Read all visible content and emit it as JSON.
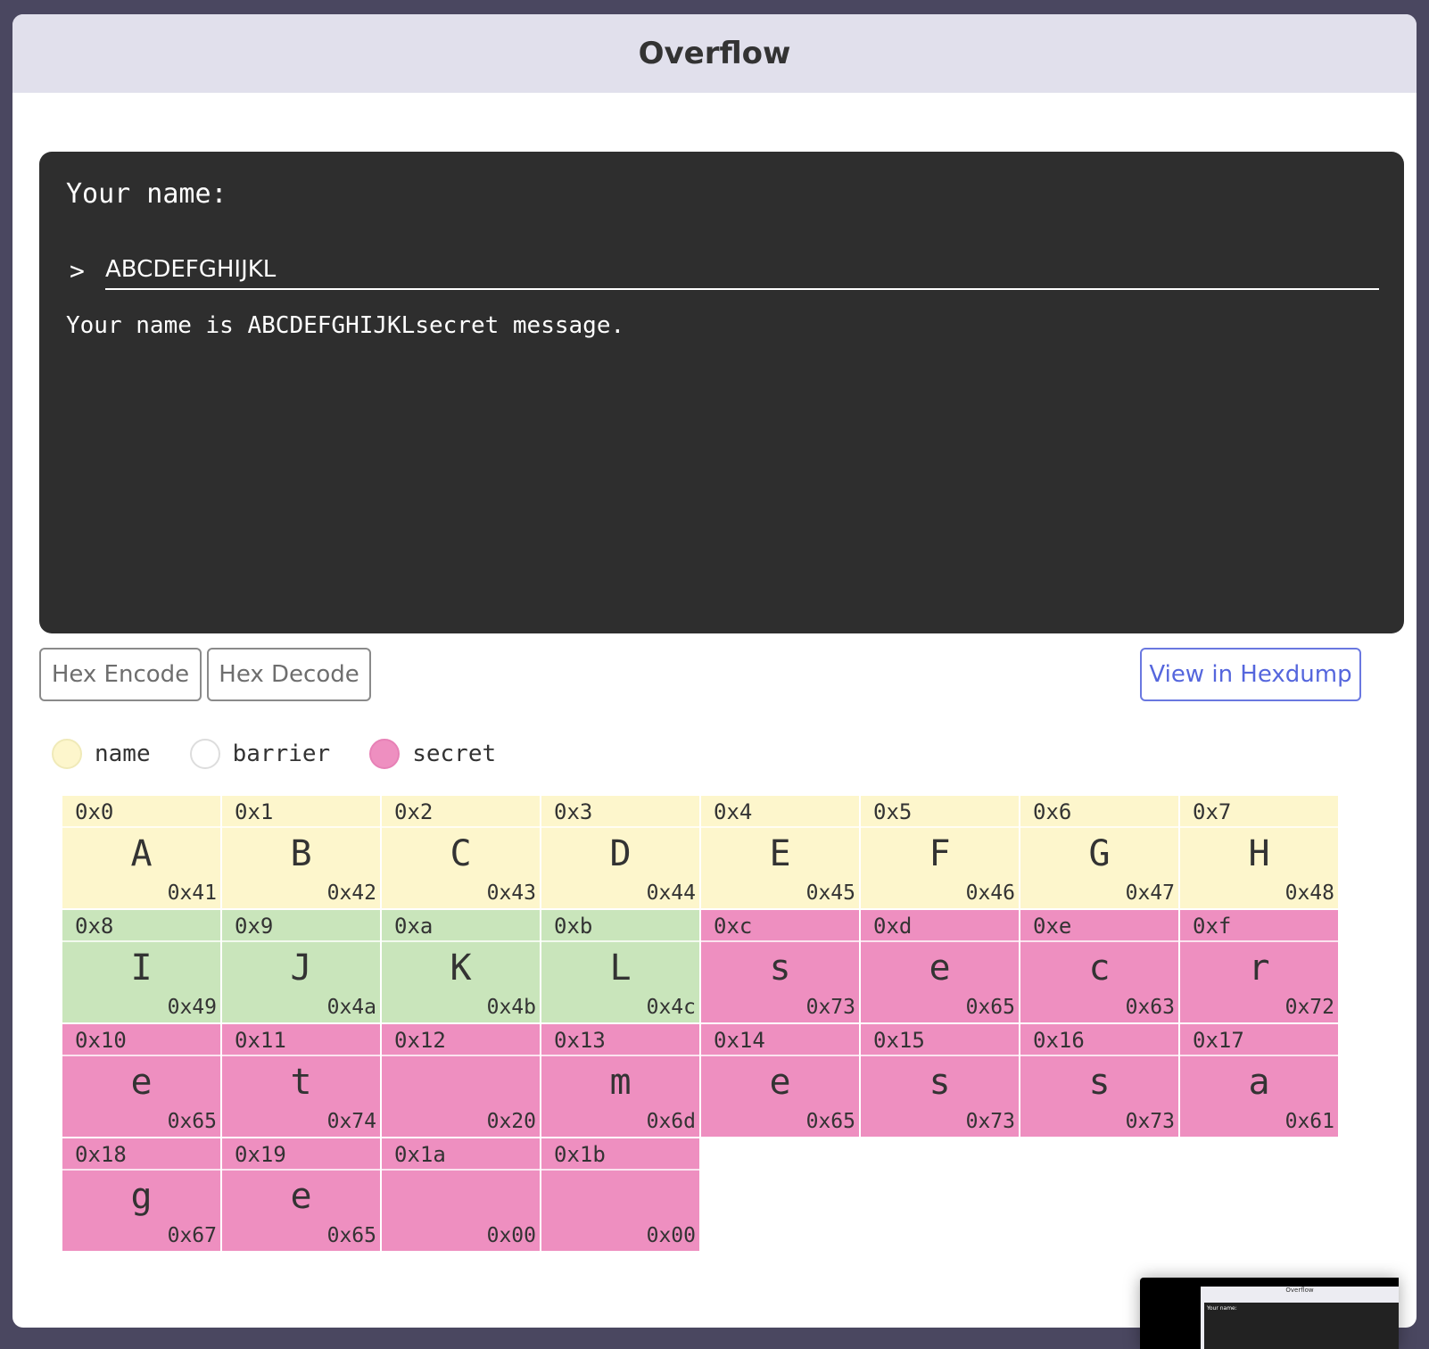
{
  "window": {
    "title": "Overflow"
  },
  "terminal": {
    "prompt": "Your name:",
    "chevron": ">",
    "input_value": "ABCDEFGHIJKL",
    "output": "Your name is ABCDEFGHIJKLsecret message."
  },
  "buttons": {
    "hex_encode": "Hex Encode",
    "hex_decode": "Hex Decode",
    "hexdump": "View in Hexdump"
  },
  "legend": [
    {
      "label": "name",
      "color": "#fdf6cc"
    },
    {
      "label": "barrier",
      "color": "#ffffff"
    },
    {
      "label": "secret",
      "color": "#ee8fc0"
    }
  ],
  "colors": {
    "name": "#fdf6cc",
    "barrier": "#c9e5bb",
    "secret": "#ee8fc0",
    "accent": "#5566dd"
  },
  "memory": [
    {
      "addr": "0x0",
      "char": "A",
      "hex": "0x41",
      "region": "name"
    },
    {
      "addr": "0x1",
      "char": "B",
      "hex": "0x42",
      "region": "name"
    },
    {
      "addr": "0x2",
      "char": "C",
      "hex": "0x43",
      "region": "name"
    },
    {
      "addr": "0x3",
      "char": "D",
      "hex": "0x44",
      "region": "name"
    },
    {
      "addr": "0x4",
      "char": "E",
      "hex": "0x45",
      "region": "name"
    },
    {
      "addr": "0x5",
      "char": "F",
      "hex": "0x46",
      "region": "name"
    },
    {
      "addr": "0x6",
      "char": "G",
      "hex": "0x47",
      "region": "name"
    },
    {
      "addr": "0x7",
      "char": "H",
      "hex": "0x48",
      "region": "name"
    },
    {
      "addr": "0x8",
      "char": "I",
      "hex": "0x49",
      "region": "barrier"
    },
    {
      "addr": "0x9",
      "char": "J",
      "hex": "0x4a",
      "region": "barrier"
    },
    {
      "addr": "0xa",
      "char": "K",
      "hex": "0x4b",
      "region": "barrier"
    },
    {
      "addr": "0xb",
      "char": "L",
      "hex": "0x4c",
      "region": "barrier"
    },
    {
      "addr": "0xc",
      "char": "s",
      "hex": "0x73",
      "region": "secret"
    },
    {
      "addr": "0xd",
      "char": "e",
      "hex": "0x65",
      "region": "secret"
    },
    {
      "addr": "0xe",
      "char": "c",
      "hex": "0x63",
      "region": "secret"
    },
    {
      "addr": "0xf",
      "char": "r",
      "hex": "0x72",
      "region": "secret"
    },
    {
      "addr": "0x10",
      "char": "e",
      "hex": "0x65",
      "region": "secret"
    },
    {
      "addr": "0x11",
      "char": "t",
      "hex": "0x74",
      "region": "secret"
    },
    {
      "addr": "0x12",
      "char": "",
      "hex": "0x20",
      "region": "secret"
    },
    {
      "addr": "0x13",
      "char": "m",
      "hex": "0x6d",
      "region": "secret"
    },
    {
      "addr": "0x14",
      "char": "e",
      "hex": "0x65",
      "region": "secret"
    },
    {
      "addr": "0x15",
      "char": "s",
      "hex": "0x73",
      "region": "secret"
    },
    {
      "addr": "0x16",
      "char": "s",
      "hex": "0x73",
      "region": "secret"
    },
    {
      "addr": "0x17",
      "char": "a",
      "hex": "0x61",
      "region": "secret"
    },
    {
      "addr": "0x18",
      "char": "g",
      "hex": "0x67",
      "region": "secret"
    },
    {
      "addr": "0x19",
      "char": "e",
      "hex": "0x65",
      "region": "secret"
    },
    {
      "addr": "0x1a",
      "char": "",
      "hex": "0x00",
      "region": "secret"
    },
    {
      "addr": "0x1b",
      "char": "",
      "hex": "0x00",
      "region": "secret"
    }
  ],
  "thumbnail": {
    "title": "Overflow",
    "prompt": "Your name:"
  }
}
